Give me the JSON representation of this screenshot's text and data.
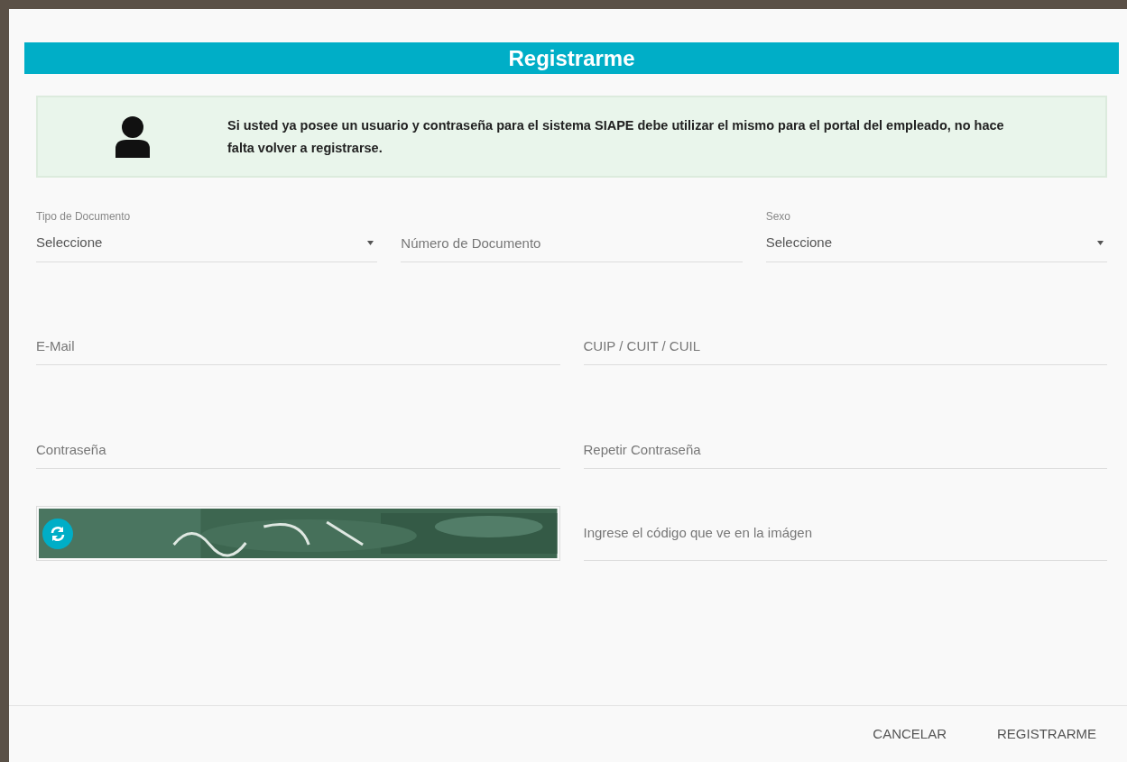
{
  "title": "Registrarme",
  "notice": {
    "text": "Si usted ya posee un usuario y contraseña para el sistema SIAPE debe utilizar el mismo para el portal del empleado, no hace falta volver a registrarse."
  },
  "rows": [
    {
      "fields": [
        {
          "kind": "select",
          "label": "Tipo de Documento",
          "value": "Seleccione"
        },
        {
          "kind": "input",
          "placeholder": "Número de Documento"
        },
        {
          "kind": "select",
          "label": "Sexo",
          "value": "Seleccione"
        }
      ]
    },
    {
      "fields": [
        {
          "kind": "input",
          "placeholder": "E-Mail"
        },
        {
          "kind": "input",
          "placeholder": "CUIP / CUIT / CUIL"
        }
      ]
    },
    {
      "fields": [
        {
          "kind": "input",
          "placeholder": "Contraseña"
        },
        {
          "kind": "input",
          "placeholder": "Repetir Contraseña"
        }
      ]
    },
    {
      "fields": [
        {
          "kind": "captcha"
        },
        {
          "kind": "input",
          "placeholder": "Ingrese el código que ve en la imágen"
        }
      ]
    }
  ],
  "buttons": [
    "CANCELAR",
    "REGISTRARME"
  ]
}
